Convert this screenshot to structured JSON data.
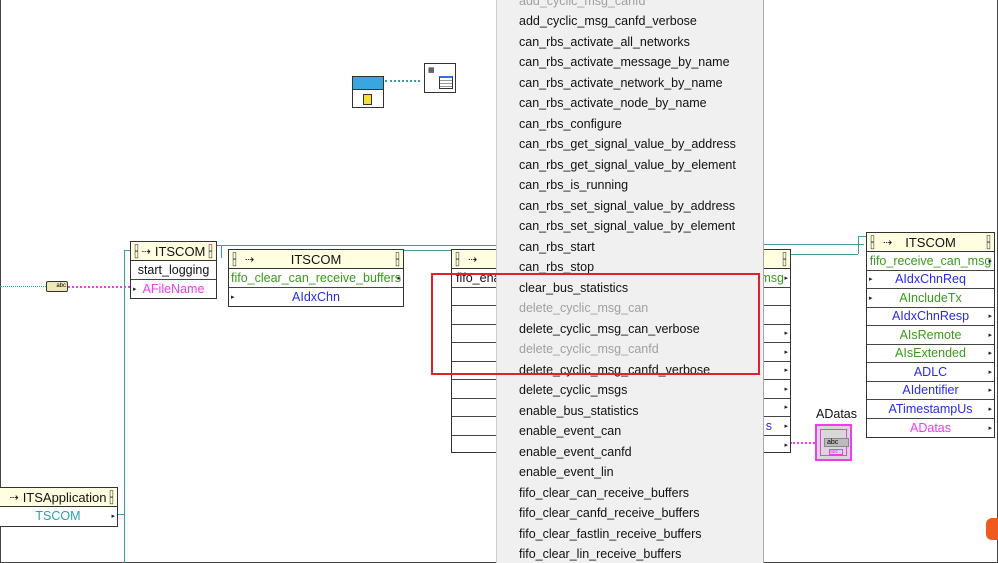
{
  "nodes": {
    "start_logging": {
      "class": "ITSCOM",
      "method": "start_logging",
      "params": [
        "AFileName"
      ]
    },
    "fifo_clear": {
      "class": "ITSCOM",
      "method": "fifo_clear_can_receive_buffers",
      "params": [
        "AIdxChn"
      ]
    },
    "middle": {
      "method_partial": "fifo_ena",
      "method_tail": "msg",
      "param_tail": "s"
    },
    "fifo_receive": {
      "class": "ITSCOM",
      "method": "fifo_receive_can_msg",
      "params": [
        "AIdxChnReq",
        "AIncludeTx",
        "AIdxChnResp",
        "AIsRemote",
        "AIsExtended",
        "ADLC",
        "AIdentifier",
        "ATimestampUs",
        "ADatas"
      ]
    },
    "application": {
      "class": "ITSApplication",
      "property": "TSCOM"
    }
  },
  "indicator": {
    "label": "ADatas",
    "value": "abc",
    "type_label": "abc"
  },
  "constant": {
    "value": "abc"
  },
  "menu": {
    "items": [
      {
        "label": "add_cyclic_msg_canfd",
        "enabled": false
      },
      {
        "label": "add_cyclic_msg_canfd_verbose",
        "enabled": true
      },
      {
        "label": "can_rbs_activate_all_networks",
        "enabled": true
      },
      {
        "label": "can_rbs_activate_message_by_name",
        "enabled": true
      },
      {
        "label": "can_rbs_activate_network_by_name",
        "enabled": true
      },
      {
        "label": "can_rbs_activate_node_by_name",
        "enabled": true
      },
      {
        "label": "can_rbs_configure",
        "enabled": true
      },
      {
        "label": "can_rbs_get_signal_value_by_address",
        "enabled": true
      },
      {
        "label": "can_rbs_get_signal_value_by_element",
        "enabled": true
      },
      {
        "label": "can_rbs_is_running",
        "enabled": true
      },
      {
        "label": "can_rbs_set_signal_value_by_address",
        "enabled": true
      },
      {
        "label": "can_rbs_set_signal_value_by_element",
        "enabled": true
      },
      {
        "label": "can_rbs_start",
        "enabled": true
      },
      {
        "label": "can_rbs_stop",
        "enabled": true
      },
      {
        "label": "clear_bus_statistics",
        "enabled": true
      },
      {
        "label": "delete_cyclic_msg_can",
        "enabled": false
      },
      {
        "label": "delete_cyclic_msg_can_verbose",
        "enabled": true
      },
      {
        "label": "delete_cyclic_msg_canfd",
        "enabled": false
      },
      {
        "label": "delete_cyclic_msg_canfd_verbose",
        "enabled": true
      },
      {
        "label": "delete_cyclic_msgs",
        "enabled": true
      },
      {
        "label": "enable_bus_statistics",
        "enabled": true
      },
      {
        "label": "enable_event_can",
        "enabled": true
      },
      {
        "label": "enable_event_canfd",
        "enabled": true
      },
      {
        "label": "enable_event_lin",
        "enabled": true
      },
      {
        "label": "fifo_clear_can_receive_buffers",
        "enabled": true
      },
      {
        "label": "fifo_clear_canfd_receive_buffers",
        "enabled": true
      },
      {
        "label": "fifo_clear_fastlin_receive_buffers",
        "enabled": true
      },
      {
        "label": "fifo_clear_lin_receive_buffers",
        "enabled": true
      }
    ]
  },
  "colors": {
    "highlight_box": "#e0202a",
    "wire_refnum": "#3a9ea0",
    "wire_string": "#f03cf0",
    "node_header": "#fffee0"
  }
}
